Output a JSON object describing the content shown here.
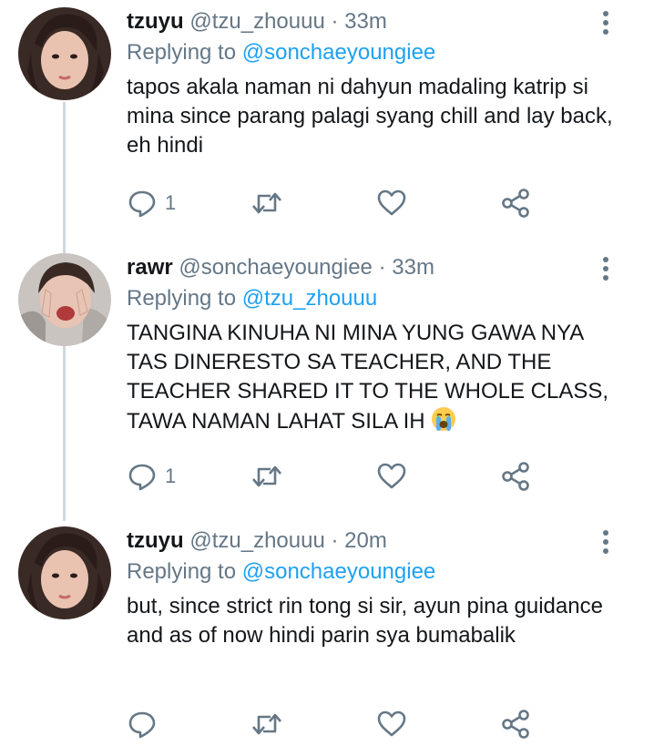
{
  "tweets": [
    {
      "name": "tzuyu",
      "handle": "@tzu_zhouuu",
      "separator": "·",
      "time": "33m",
      "replying_prefix": "Replying to",
      "replying_to": "@sonchaeyoungiee",
      "text": "tapos akala naman ni dahyun madaling katrip si mina since parang palagi syang chill and lay back, eh hindi",
      "reply_count": "1"
    },
    {
      "name": "rawr",
      "handle": "@sonchaeyoungiee",
      "separator": "·",
      "time": "33m",
      "replying_prefix": "Replying to",
      "replying_to": "@tzu_zhouuu",
      "text": "TANGINA KINUHA NI MINA YUNG GAWA NYA TAS DINERESTO SA TEACHER, AND THE TEACHER SHARED IT TO THE WHOLE CLASS, TAWA NAMAN LAHAT SILA IH",
      "reply_count": "1"
    },
    {
      "name": "tzuyu",
      "handle": "@tzu_zhouuu",
      "separator": "·",
      "time": "20m",
      "replying_prefix": "Replying to",
      "replying_to": "@sonchaeyoungiee",
      "text": "but, since strict rin tong si sir, ayun pina guidance and as of now hindi parin sya bumabalik",
      "reply_count": ""
    }
  ],
  "colors": {
    "text": "#14171a",
    "secondary": "#657786",
    "link": "#1da1f2",
    "thread_line": "#cfd9de"
  },
  "icons": [
    "reply-icon",
    "retweet-icon",
    "like-icon",
    "share-icon",
    "more-options-icon",
    "loudly-crying-face-emoji"
  ]
}
